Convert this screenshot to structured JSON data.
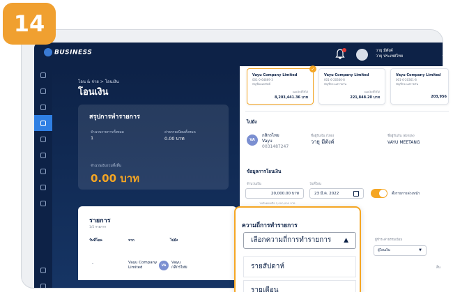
{
  "step": "14",
  "topbar": {
    "logo": "BUSINESS",
    "user_line1": "วายุ มีตังค์",
    "user_line2": "วายุ ประเทศไทย"
  },
  "header": {
    "breadcrumb": "โอน & จ่าย > โอนเงิน",
    "title": "โอนเงิน"
  },
  "summary": {
    "title": "สรุปการทำรายการ",
    "count_label": "จำนวนรายการทั้งหมด",
    "count_value": "1",
    "fee_label": "ค่าธรรมเนียมทั้งหมด",
    "fee_value": "0.00 บาท",
    "total_label": "จำนวนเงินรวมทั้งสิ้น",
    "total_value": "0.00 บาท"
  },
  "list": {
    "title": "รายการ",
    "subtitle": "1/5 รายการ",
    "headers": [
      "วันที่โอน",
      "จาก",
      "ไปยัง"
    ],
    "row": {
      "date": "-",
      "from": "Vayu Company Limited",
      "to_initials": "VA",
      "to_name": "Vayu",
      "to_bank": "กสิกรไทย"
    }
  },
  "accounts": [
    {
      "name": "Vayu Company Limited",
      "number": "001-0-64869-3",
      "type": "บัญชีออมทรัพย์",
      "balance_label": "ยอดเงินที่ใช้ได้",
      "balance": "8,203,441.36 บาท"
    },
    {
      "name": "Vayu Company Limited",
      "number": "001-6-20360-8",
      "type": "บัญชีกระแสรายวัน",
      "balance_label": "ยอดเงินที่ใช้ได้",
      "balance": "221,848.20 บาท"
    },
    {
      "name": "Vayu Company Limited",
      "number": "001-6-20361-8",
      "type": "บัญชีกระแสรายวัน",
      "balance_label": "ยอดเงินที่ใช้ได้",
      "balance": "203,956"
    }
  ],
  "recipient": {
    "section": "ไปยัง",
    "initials": "VA",
    "bank": "กสิกรไทย",
    "name": "Vayu",
    "account": "0031487247",
    "name_th_label": "ชื่อผู้รับเงิน (ไทย)",
    "name_th": "วายุ มีตังค์",
    "name_en_label": "ชื่อผู้รับเงิน (อังกฤษ)",
    "name_en": "VAYU MEETANG"
  },
  "transfer": {
    "section": "ข้อมูลการโอนเงิน",
    "amount_label": "จำนวนเงิน",
    "amount": "20,000.00 บาท",
    "amount_hint": "วงเงินคงเหลือ 2,000,000 บาท",
    "date_label": "วันที่โอน",
    "date": "23 มี.ค. 2022",
    "toggle_label": "ตั้งรายการล่วงหน้า",
    "payer_label": "ผู้ชำระค่าธรรมเนียม",
    "payer_value": "ผู้โอนเงิน",
    "end_label": "สิ้น"
  },
  "frequency_zoom": {
    "label": "ความถี่การทำรายการ",
    "placeholder": "เลือกความถี่การทำรายการ",
    "options": [
      "รายสัปดาห์",
      "รายเดือน"
    ]
  }
}
